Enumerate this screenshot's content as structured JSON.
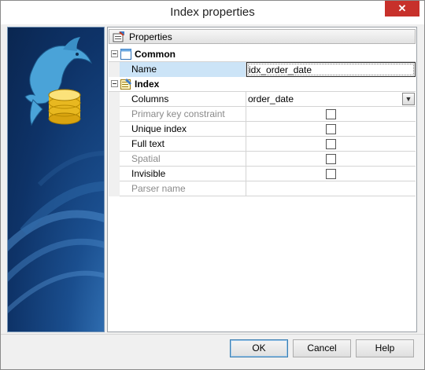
{
  "window": {
    "title": "Index properties",
    "close_label": "✕"
  },
  "panel": {
    "header_label": "Properties",
    "header_icon": "properties-icon"
  },
  "categories": [
    {
      "label": "Common",
      "icon": "common-icon",
      "properties": [
        {
          "name": "Name",
          "value": "idx_order_date",
          "kind": "text",
          "selected": true,
          "disabled": false
        }
      ]
    },
    {
      "label": "Index",
      "icon": "index-icon",
      "properties": [
        {
          "name": "Columns",
          "value": "order_date",
          "kind": "dropdown",
          "selected": false,
          "disabled": false
        },
        {
          "name": "Primary key constraint",
          "value": "",
          "kind": "checkbox",
          "checked": false,
          "disabled": true
        },
        {
          "name": "Unique index",
          "value": "",
          "kind": "checkbox",
          "checked": false,
          "disabled": false
        },
        {
          "name": "Full text",
          "value": "",
          "kind": "checkbox",
          "checked": false,
          "disabled": false
        },
        {
          "name": "Spatial",
          "value": "",
          "kind": "checkbox",
          "checked": false,
          "disabled": true
        },
        {
          "name": "Invisible",
          "value": "",
          "kind": "checkbox",
          "checked": false,
          "disabled": false
        },
        {
          "name": "Parser name",
          "value": "",
          "kind": "text",
          "selected": false,
          "disabled": true
        }
      ]
    }
  ],
  "buttons": {
    "ok_label": "OK",
    "cancel_label": "Cancel",
    "help_label": "Help"
  },
  "colors": {
    "selected_row": "#cce4f7",
    "close_button": "#c7312b",
    "default_button_border": "#3c7fb1"
  }
}
